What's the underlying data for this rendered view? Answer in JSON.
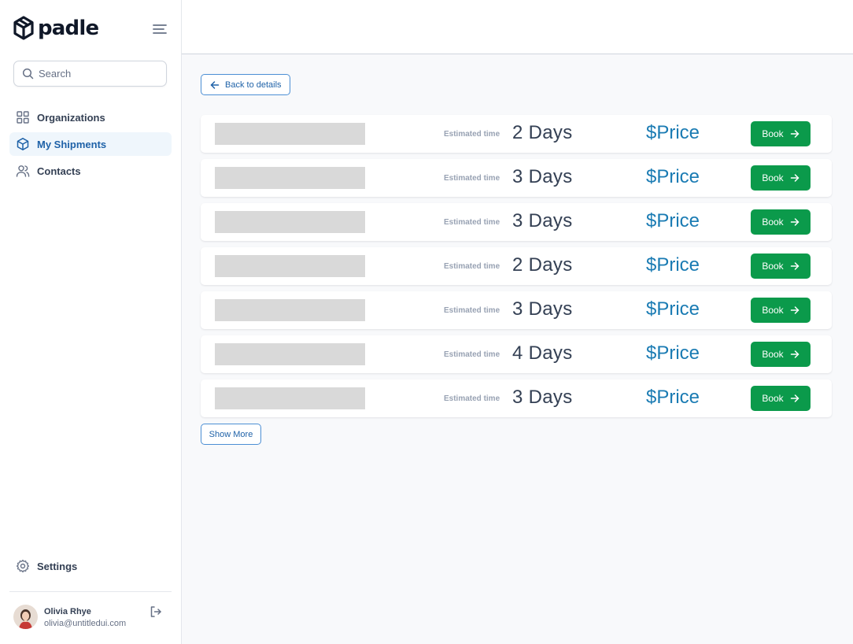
{
  "brand": {
    "name": "padle"
  },
  "search": {
    "placeholder": "Search"
  },
  "nav": [
    {
      "label": "Organizations",
      "icon": "grid-icon",
      "active": false
    },
    {
      "label": "My Shipments",
      "icon": "box-icon",
      "active": true
    },
    {
      "label": "Contacts",
      "icon": "users-icon",
      "active": false
    }
  ],
  "settings": {
    "label": "Settings"
  },
  "user": {
    "name": "Olivia Rhye",
    "email": "olivia@untitledui.com"
  },
  "main": {
    "back_label": "Back to details",
    "estimated_label": "Estimated time",
    "book_label": "Book",
    "show_more_label": "Show More",
    "rows": [
      {
        "days": "2 Days",
        "price": "$Price"
      },
      {
        "days": "3 Days",
        "price": "$Price"
      },
      {
        "days": "3 Days",
        "price": "$Price"
      },
      {
        "days": "2 Days",
        "price": "$Price"
      },
      {
        "days": "3 Days",
        "price": "$Price"
      },
      {
        "days": "4 Days",
        "price": "$Price"
      },
      {
        "days": "3 Days",
        "price": "$Price"
      }
    ]
  },
  "colors": {
    "primary": "#1f62a8",
    "price": "#1a7bb3",
    "book": "#0b9a4b",
    "active_bg": "#eff6fc"
  }
}
